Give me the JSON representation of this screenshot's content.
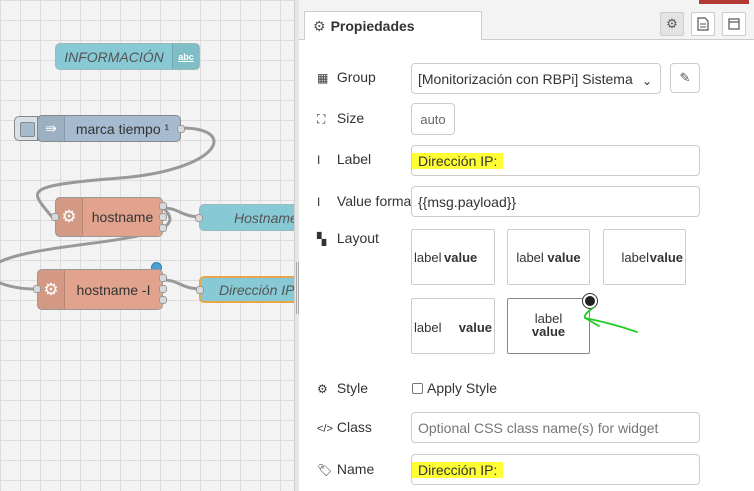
{
  "workspace": {
    "nodes": {
      "info": "INFORMACIÓN",
      "info_icon": "abc",
      "marca": "marca tiempo ¹",
      "hostname1": "hostname",
      "hostname2": "hostname -I",
      "text1": "Hostname",
      "text2": "Dirección IP:"
    }
  },
  "editor": {
    "tab_label": "Propiedades",
    "tab_icon": "gear-icon",
    "buttons": [
      "gear-icon",
      "description-icon",
      "appearance-icon"
    ],
    "fields": {
      "group_label": "Group",
      "group_value": "[Monitorización con RBPi] Sistema",
      "size_label": "Size",
      "size_value": "auto",
      "label_label": "Label",
      "label_value": "Dirección IP:",
      "format_label": "Value format",
      "format_value": "{{msg.payload}}",
      "layout_label": "Layout",
      "style_label": "Style",
      "apply_style": "Apply Style",
      "class_label": "Class",
      "class_placeholder": "Optional CSS class name(s) for widget",
      "name_label": "Name",
      "name_value": "Dirección IP:"
    },
    "layout_options": [
      {
        "label": "label",
        "value": "value"
      },
      {
        "label": "label",
        "value": "value"
      },
      {
        "label": "label",
        "value": "value"
      },
      {
        "label": "label",
        "value": "value"
      },
      {
        "label": "label",
        "value": "value"
      }
    ],
    "selected_layout": 4,
    "highlight_color": "#ffff33",
    "annotation_color": "#22cc22"
  }
}
